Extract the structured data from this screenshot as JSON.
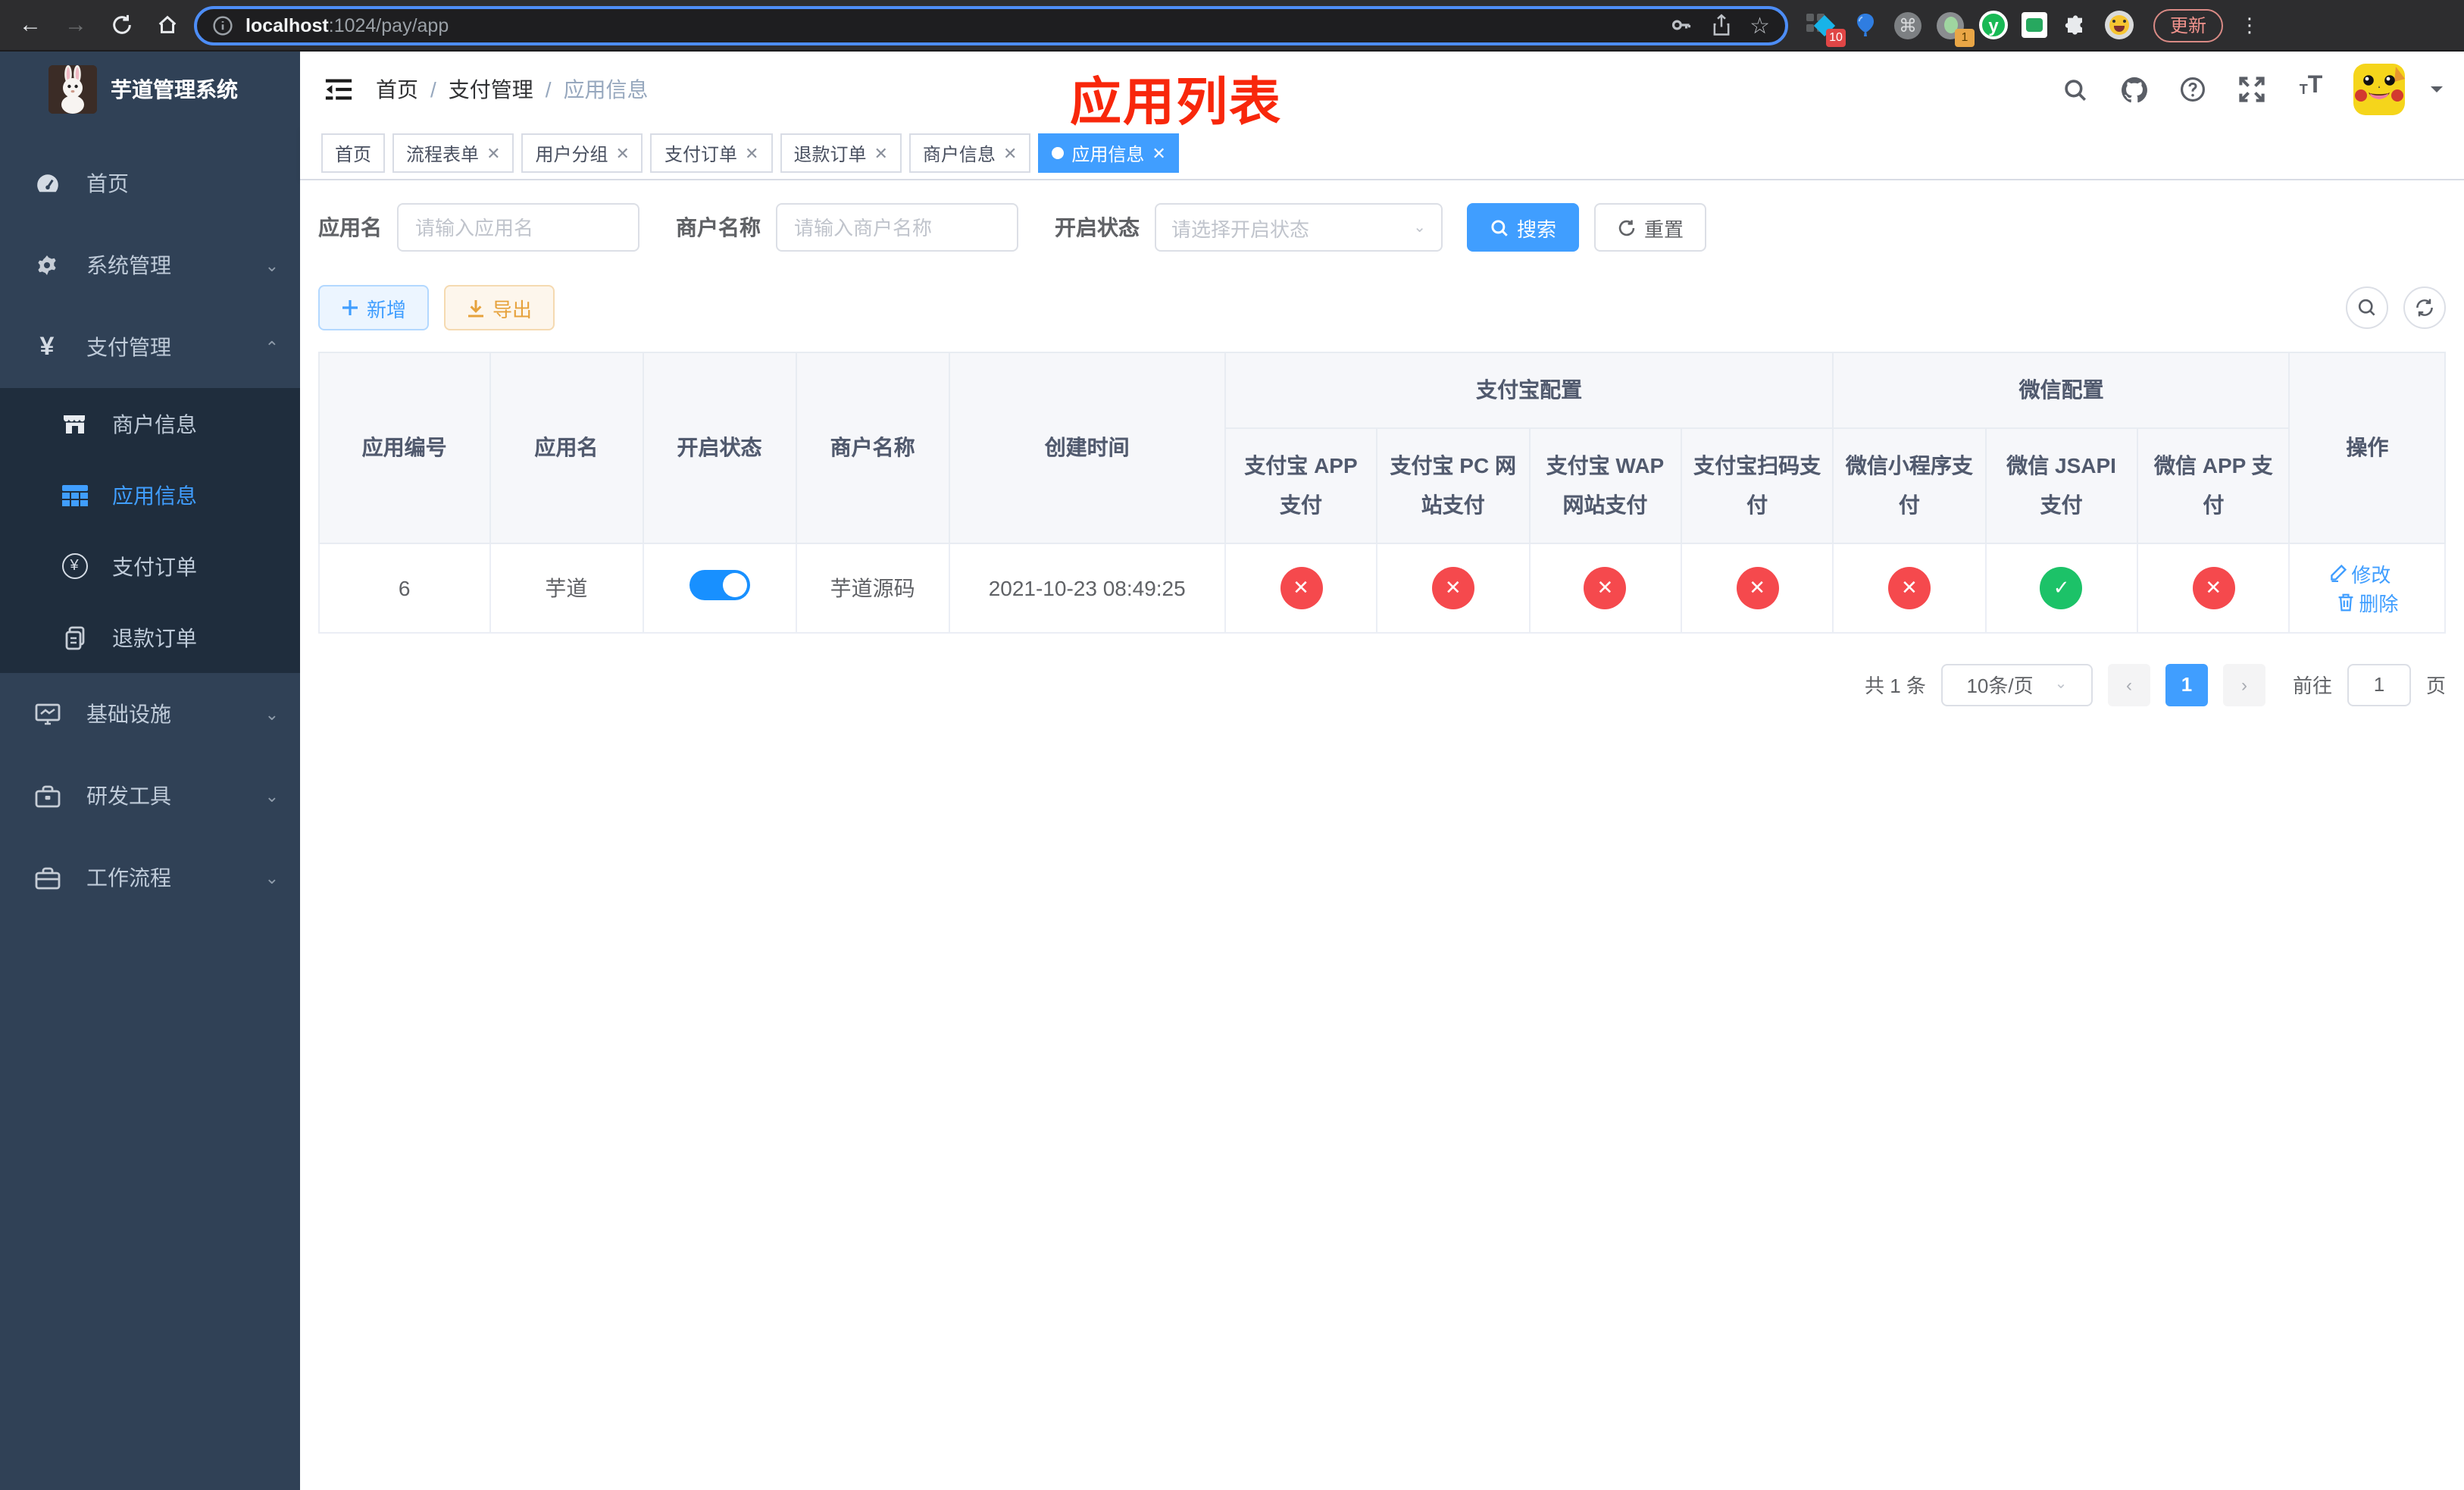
{
  "colors": {
    "primary": "#409eff",
    "primary_bright": "#1890ff",
    "danger": "#f5494d",
    "success": "#1cc268",
    "warning": "#e6a23c",
    "annotation": "#f8270b",
    "sidebar_bg": "#304156",
    "submenu_bg": "#1f2d3d",
    "sidebar_text": "#bfcbd9"
  },
  "icons": {
    "back": "←",
    "forward": "→",
    "command": "⌘",
    "kebab": "⋮",
    "star": "☆",
    "yen": "¥",
    "check": "✓",
    "cross": "✕",
    "chevron_down": "⌄",
    "chevron_up": "⌃",
    "prev_arrow": "‹",
    "next_arrow": "›",
    "ext_y": "y"
  },
  "browser": {
    "url_host": "localhost",
    "url_rest": ":1024/pay/app",
    "ext_badge_blue_diamond": "10",
    "ext_badge_gray_circle": "1",
    "update_button": "更新"
  },
  "sidebar": {
    "title": "芋道管理系统",
    "items": [
      {
        "label": "首页",
        "icon": "dashboard-icon",
        "expandable": false
      },
      {
        "label": "系统管理",
        "icon": "gear-icon",
        "expandable": true,
        "expanded": false
      },
      {
        "label": "支付管理",
        "icon": "yen-icon",
        "expandable": true,
        "expanded": true
      },
      {
        "label": "基础设施",
        "icon": "monitor-icon",
        "expandable": true,
        "expanded": false
      },
      {
        "label": "研发工具",
        "icon": "toolbox-icon",
        "expandable": true,
        "expanded": false
      },
      {
        "label": "工作流程",
        "icon": "briefcase-icon",
        "expandable": true,
        "expanded": false
      }
    ],
    "subitems": [
      {
        "label": "商户信息",
        "icon": "storefront-icon",
        "active": false
      },
      {
        "label": "应用信息",
        "icon": "grid-icon",
        "active": true
      },
      {
        "label": "支付订单",
        "icon": "yen-circle-icon",
        "active": false
      },
      {
        "label": "退款订单",
        "icon": "document-icon",
        "active": false
      }
    ]
  },
  "breadcrumb": {
    "home": "首页",
    "section": "支付管理",
    "current": "应用信息",
    "separator": "/"
  },
  "annotation": "应用列表",
  "tabs": [
    {
      "label": "首页",
      "closable": false,
      "active": false
    },
    {
      "label": "流程表单",
      "closable": true,
      "active": false
    },
    {
      "label": "用户分组",
      "closable": true,
      "active": false
    },
    {
      "label": "支付订单",
      "closable": true,
      "active": false
    },
    {
      "label": "退款订单",
      "closable": true,
      "active": false
    },
    {
      "label": "商户信息",
      "closable": true,
      "active": false
    },
    {
      "label": "应用信息",
      "closable": true,
      "active": true
    }
  ],
  "filters": {
    "app_name_label": "应用名",
    "app_name_placeholder": "请输入应用名",
    "merchant_label": "商户名称",
    "merchant_placeholder": "请输入商户名称",
    "status_label": "开启状态",
    "status_placeholder": "请选择开启状态",
    "search_button": "搜索",
    "reset_button": "重置"
  },
  "toolbar": {
    "add_button": "新增",
    "export_button": "导出"
  },
  "table": {
    "columns": [
      "应用编号",
      "应用名",
      "开启状态",
      "商户名称",
      "创建时间"
    ],
    "alipay_group": "支付宝配置",
    "alipay_columns": [
      "支付宝 APP 支付",
      "支付宝 PC 网站支付",
      "支付宝 WAP 网站支付",
      "支付宝扫码支付"
    ],
    "wechat_group": "微信配置",
    "wechat_columns": [
      "微信小程序支付",
      "微信 JSAPI 支付",
      "微信 APP 支付"
    ],
    "action_column": "操作",
    "row": {
      "id": "6",
      "name": "芋道",
      "enabled": true,
      "merchant": "芋道源码",
      "created": "2021-10-23 08:49:25",
      "statuses": [
        "fail",
        "fail",
        "fail",
        "fail",
        "fail",
        "pass",
        "fail"
      ],
      "edit_label": "修改",
      "delete_label": "删除"
    }
  },
  "pagination": {
    "total_text": "共 1 条",
    "page_size": "10条/页",
    "current_page": "1",
    "goto_label": "前往",
    "goto_value": "1",
    "page_unit": "页"
  }
}
